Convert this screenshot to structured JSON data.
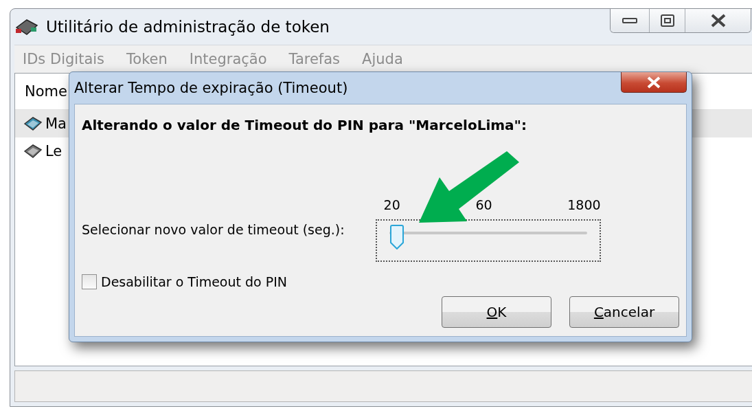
{
  "window": {
    "title": "Utilitário de administração de token"
  },
  "menu": [
    "IDs Digitais",
    "Token",
    "Integração",
    "Tarefas",
    "Ajuda"
  ],
  "list": {
    "columns": [
      "Nome"
    ],
    "rows": [
      {
        "name": "Ma",
        "selected": true
      },
      {
        "name": "Le",
        "selected": false
      }
    ]
  },
  "dialog": {
    "title": "Alterar Tempo de expiração (Timeout)",
    "heading": "Alterando o valor de Timeout do PIN para \"MarceloLima\":",
    "slider": {
      "label": "Selecionar novo valor de timeout (seg.):",
      "ticks": [
        "20",
        "60",
        "1800"
      ],
      "level": 0.04
    },
    "checkbox": {
      "label": "Desabilitar o Timeout do PIN",
      "checked": false
    },
    "buttons": [
      {
        "label": "OK"
      },
      {
        "label": "Cancelar"
      }
    ]
  }
}
